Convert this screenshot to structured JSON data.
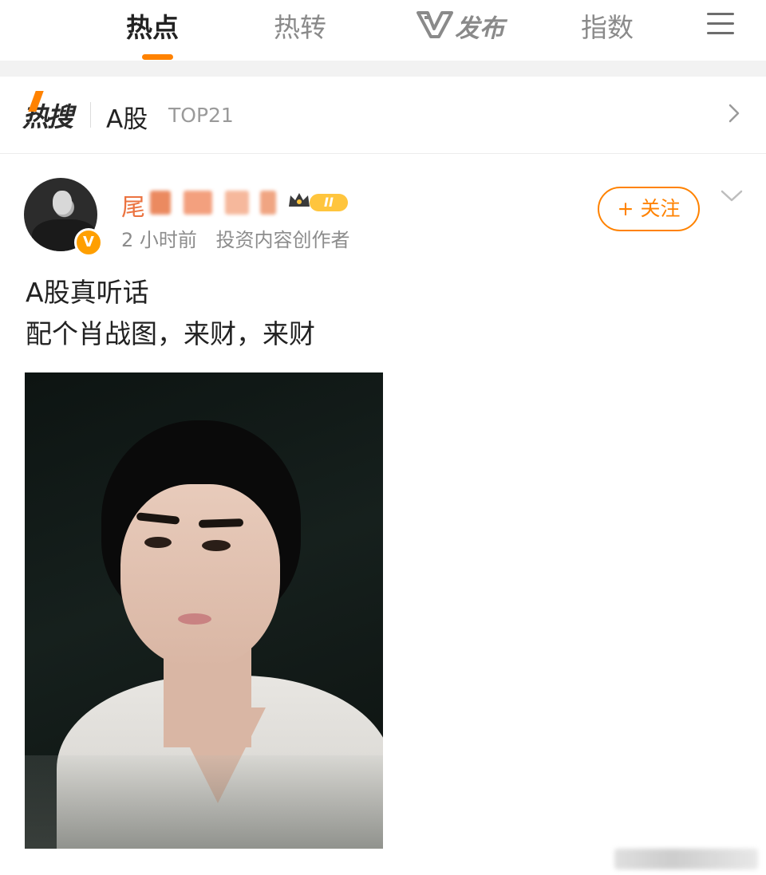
{
  "top_nav": {
    "tabs": [
      {
        "label": "热点",
        "active": true
      },
      {
        "label": "热转",
        "active": false
      },
      {
        "label": "发布",
        "active": false
      },
      {
        "label": "指数",
        "active": false
      }
    ],
    "publish_icon": "v-logo-icon",
    "menu_icon": "hamburger-menu-icon"
  },
  "hot_search": {
    "logo_text": "热搜",
    "topic": "A股",
    "rank": "TOP21",
    "chevron_icon": "chevron-right-icon"
  },
  "post": {
    "author": {
      "name_visible": "尾",
      "name_blurred": true,
      "verified_badge": "V",
      "level_badge": "II",
      "crown_icon": "crown-icon"
    },
    "meta": {
      "time": "2 小时前",
      "role": "投资内容创作者"
    },
    "follow_button": "+ 关注",
    "more_icon": "chevron-down-icon",
    "text_lines": [
      "A股真听话",
      "配个肖战图，来财，来财"
    ],
    "photo_icon": "portrait-photo"
  },
  "colors": {
    "accent": "#ff8200",
    "username": "#eb7340",
    "muted": "#8c8c8c"
  }
}
